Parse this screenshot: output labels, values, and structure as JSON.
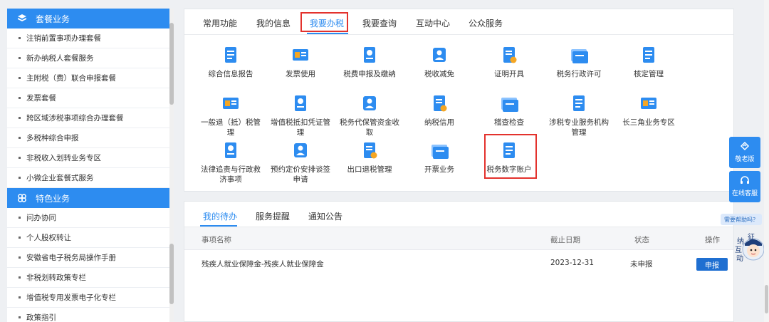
{
  "sidebar": {
    "section1": {
      "title": "套餐业务",
      "icon": "cube-icon",
      "items": [
        "注销前置事项办理套餐",
        "新办纳税人套餐服务",
        "主附税（费）联合申报套餐",
        "发票套餐",
        "跨区域涉税事项综合办理套餐",
        "多税种综合申报",
        "非税收入划转业务专区",
        "小微企业套餐式服务"
      ]
    },
    "section2": {
      "title": "特色业务",
      "icon": "clover-icon",
      "items": [
        "问办协同",
        "个人股权转让",
        "安徽省电子税务局操作手册",
        "非税划转政策专栏",
        "增值税专用发票电子化专栏",
        "政策指引"
      ]
    }
  },
  "tabs": [
    "常用功能",
    "我的信息",
    "我要办税",
    "我要查询",
    "互动中心",
    "公众服务"
  ],
  "active_tab": "我要办税",
  "services": [
    {
      "label": "综合信息报告",
      "icon": "report-doc-icon"
    },
    {
      "label": "发票使用",
      "icon": "invoice-icon"
    },
    {
      "label": "税费申报及缴纳",
      "icon": "tax-declare-icon"
    },
    {
      "label": "税收减免",
      "icon": "tax-relief-icon"
    },
    {
      "label": "证明开具",
      "icon": "certificate-icon"
    },
    {
      "label": "税务行政许可",
      "icon": "chart-permit-icon"
    },
    {
      "label": "核定管理",
      "icon": "verify-person-icon"
    },
    {
      "label": "一般退（抵）税管理",
      "icon": "refund-card-icon"
    },
    {
      "label": "增值税抵扣凭证管理",
      "icon": "server-stack-icon"
    },
    {
      "label": "税务代保管资金收取",
      "icon": "clipboard-check-icon"
    },
    {
      "label": "纳税信用",
      "icon": "credit-person-icon"
    },
    {
      "label": "稽查检查",
      "icon": "inspect-doc-icon"
    },
    {
      "label": "涉税专业服务机构管理",
      "icon": "agency-building-icon"
    },
    {
      "label": "长三角业务专区",
      "icon": "region-building-icon"
    },
    {
      "label": "法律追责与行政救济事项",
      "icon": "legal-person-icon"
    },
    {
      "label": "预约定价安排谈签申请",
      "icon": "appointment-person-icon"
    },
    {
      "label": "出口退税管理",
      "icon": "export-person-icon"
    },
    {
      "label": "开票业务",
      "icon": "invoicing-icon"
    },
    {
      "label": "税务数字账户",
      "icon": "digital-account-icon"
    }
  ],
  "lower": {
    "tabs": [
      "我的待办",
      "服务提醒",
      "通知公告"
    ],
    "active_tab": "我的待办",
    "columns": [
      "事项名称",
      "截止日期",
      "状态",
      "操作"
    ],
    "rows": [
      {
        "name": "残疾人就业保障金-残疾人就业保障金",
        "deadline": "2023-12-31",
        "status": "未申报",
        "action": "申报"
      }
    ]
  },
  "floats": {
    "elder": "敬老版",
    "service": "在线客服",
    "help": "需要帮助吗？",
    "mascot_text": [
      "征",
      "纳",
      "互",
      "动"
    ]
  },
  "colors": {
    "primary": "#2d8cf0",
    "highlight": "#e3322d",
    "button": "#1f6fd1"
  }
}
